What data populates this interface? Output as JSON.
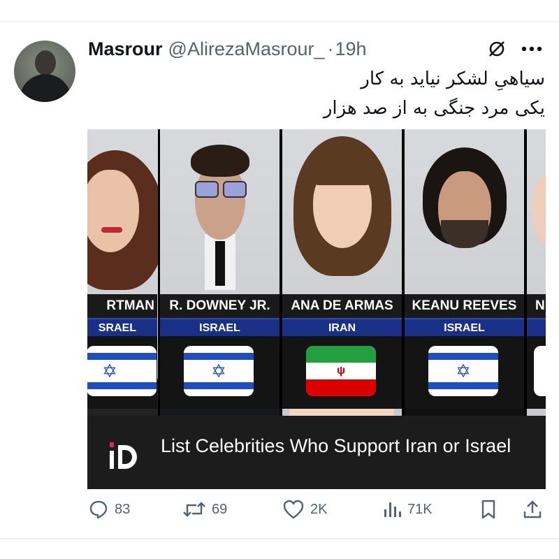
{
  "tweet": {
    "display_name": "Masrour",
    "handle": "@AlirezaMasrour_",
    "separator": "·",
    "time": "19h",
    "text_lines": [
      "سیاهیِ لشکر نیاید به کار",
      "یکی مرد جنگی به از صد هزار"
    ]
  },
  "media": {
    "celebrities": [
      {
        "name": "RTMAN",
        "country": "SRAEL",
        "flag": "israel"
      },
      {
        "name": "R. DOWNEY JR.",
        "country": "ISRAEL",
        "flag": "israel"
      },
      {
        "name": "ANA DE ARMAS",
        "country": "IRAN",
        "flag": "iran"
      },
      {
        "name": "KEANU REEVES",
        "country": "ISRAEL",
        "flag": "israel"
      },
      {
        "name": "N",
        "country": "",
        "flag": "partial"
      }
    ],
    "caption": "List Celebrities Who Support Iran or Israel",
    "logo_text": "D"
  },
  "actions": {
    "replies": "83",
    "reposts": "69",
    "likes": "2K",
    "views": "71K"
  },
  "colors": {
    "israel_blue": "#1f4fbf",
    "iran_green": "#239f40",
    "iran_red": "#da0000",
    "icon_gray": "#536471"
  },
  "icons": [
    "grok-icon",
    "more-icon",
    "reply-icon",
    "repost-icon",
    "like-icon",
    "views-icon",
    "bookmark-icon",
    "share-icon"
  ]
}
